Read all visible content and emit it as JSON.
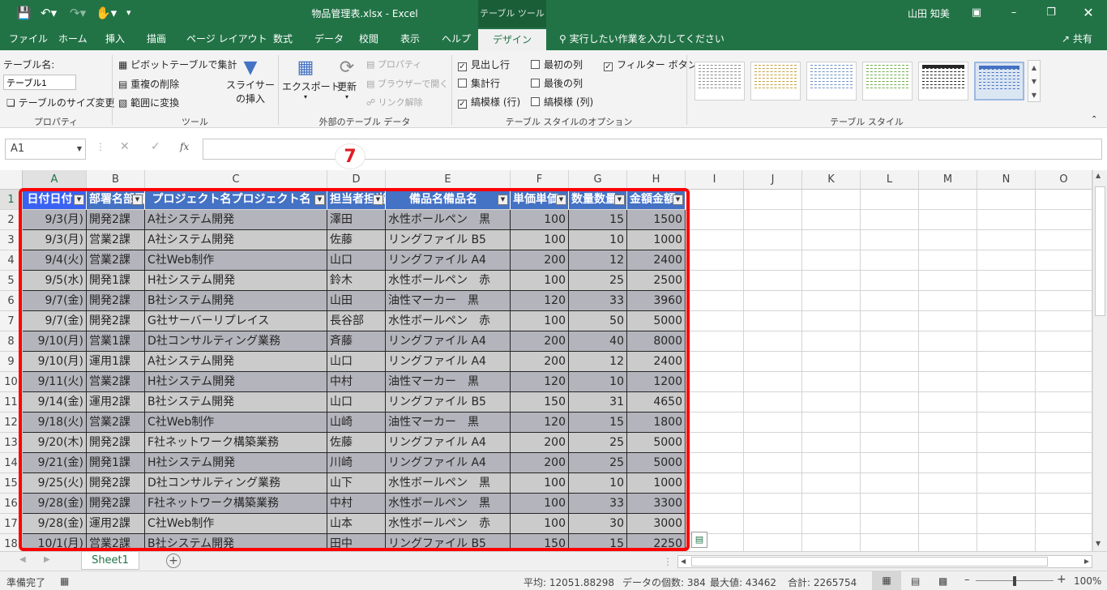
{
  "titlebar": {
    "title": "物品管理表.xlsx  -  Excel",
    "context_tools": "テーブル ツール",
    "user": "山田 知美",
    "icons": [
      "save-icon",
      "undo-icon",
      "redo-icon",
      "touch-mode-icon",
      "customize-qat-icon"
    ]
  },
  "tabs": [
    "ファイル",
    "ホーム",
    "挿入",
    "描画",
    "ページ レイアウト",
    "数式",
    "データ",
    "校閲",
    "表示",
    "ヘルプ"
  ],
  "active_tab": "デザイン",
  "tell_me": "実行したい作業を入力してください",
  "share": "共有",
  "ribbon": {
    "properties": {
      "label": "プロパティ",
      "table_name_label": "テーブル名:",
      "table_name_value": "テーブル1",
      "resize": "テーブルのサイズ変更"
    },
    "tools": {
      "label": "ツール",
      "pivot": "ピボットテーブルで集計",
      "remove_dup": "重複の削除",
      "convert": "範囲に変換",
      "slicer": "スライサーの挿入"
    },
    "external": {
      "label": "外部のテーブル データ",
      "export": "エクスポート",
      "refresh": "更新",
      "props": "プロパティ",
      "browser": "ブラウザーで開く",
      "unlink": "リンク解除"
    },
    "options": {
      "label": "テーブル スタイルのオプション",
      "items": [
        {
          "text": "見出し行",
          "checked": true
        },
        {
          "text": "最初の列",
          "checked": false
        },
        {
          "text": "フィルター ボタン",
          "checked": true
        },
        {
          "text": "集計行",
          "checked": false
        },
        {
          "text": "最後の列",
          "checked": false
        },
        {
          "text": "縞模様 (行)",
          "checked": true
        },
        {
          "text": "縞模様 (列)",
          "checked": false
        }
      ]
    },
    "styles": {
      "label": "テーブル スタイル",
      "colors": [
        "#8c8c8c",
        "#c9a13a",
        "#6a93c7",
        "#70ad47",
        "#262626",
        "#4472c4"
      ]
    }
  },
  "formula": {
    "namebox": "A1",
    "value": ""
  },
  "callout": "7",
  "columns": [
    "A",
    "B",
    "C",
    "D",
    "E",
    "F",
    "G",
    "H",
    "I",
    "J",
    "K",
    "L",
    "M",
    "N",
    "O"
  ],
  "table": {
    "headers": [
      "日付",
      "部署名",
      "プロジェクト名",
      "担当者",
      "備品名",
      "単価",
      "数量",
      "金額"
    ],
    "rows": [
      [
        "9/3(月)",
        "開発2課",
        "A社システム開発",
        "澤田",
        "水性ボールペン　黒",
        "100",
        "15",
        "1500"
      ],
      [
        "9/3(月)",
        "営業2課",
        "A社システム開発",
        "佐藤",
        "リングファイル B5",
        "100",
        "10",
        "1000"
      ],
      [
        "9/4(火)",
        "営業2課",
        "C社Web制作",
        "山口",
        "リングファイル A4",
        "200",
        "12",
        "2400"
      ],
      [
        "9/5(水)",
        "開発1課",
        "H社システム開発",
        "鈴木",
        "水性ボールペン　赤",
        "100",
        "25",
        "2500"
      ],
      [
        "9/7(金)",
        "開発2課",
        "B社システム開発",
        "山田",
        "油性マーカー　黒",
        "120",
        "33",
        "3960"
      ],
      [
        "9/7(金)",
        "開発2課",
        "G社サーバーリプレイス",
        "長谷部",
        "水性ボールペン　赤",
        "100",
        "50",
        "5000"
      ],
      [
        "9/10(月)",
        "営業1課",
        "D社コンサルティング業務",
        "斉藤",
        "リングファイル A4",
        "200",
        "40",
        "8000"
      ],
      [
        "9/10(月)",
        "運用1課",
        "A社システム開発",
        "山口",
        "リングファイル A4",
        "200",
        "12",
        "2400"
      ],
      [
        "9/11(火)",
        "営業2課",
        "H社システム開発",
        "中村",
        "油性マーカー　黒",
        "120",
        "10",
        "1200"
      ],
      [
        "9/14(金)",
        "運用2課",
        "B社システム開発",
        "山口",
        "リングファイル B5",
        "150",
        "31",
        "4650"
      ],
      [
        "9/18(火)",
        "営業2課",
        "C社Web制作",
        "山崎",
        "油性マーカー　黒",
        "120",
        "15",
        "1800"
      ],
      [
        "9/20(木)",
        "開発2課",
        "F社ネットワーク構築業務",
        "佐藤",
        "リングファイル A4",
        "200",
        "25",
        "5000"
      ],
      [
        "9/21(金)",
        "開発1課",
        "H社システム開発",
        "川崎",
        "リングファイル A4",
        "200",
        "25",
        "5000"
      ],
      [
        "9/25(火)",
        "開発2課",
        "D社コンサルティング業務",
        "山下",
        "水性ボールペン　黒",
        "100",
        "10",
        "1000"
      ],
      [
        "9/28(金)",
        "開発2課",
        "F社ネットワーク構築業務",
        "中村",
        "水性ボールペン　黒",
        "100",
        "33",
        "3300"
      ],
      [
        "9/28(金)",
        "運用2課",
        "C社Web制作",
        "山本",
        "水性ボールペン　赤",
        "100",
        "30",
        "3000"
      ],
      [
        "10/1(月)",
        "営業2課",
        "B社システム開発",
        "田中",
        "リングファイル B5",
        "150",
        "15",
        "2250"
      ]
    ]
  },
  "sheet_tab": "Sheet1",
  "status": {
    "ready": "準備完了",
    "average": "平均: 12051.88298",
    "count": "データの個数: 384",
    "max": "最大値: 43462",
    "sum": "合計: 2265754",
    "zoom": "100%"
  }
}
